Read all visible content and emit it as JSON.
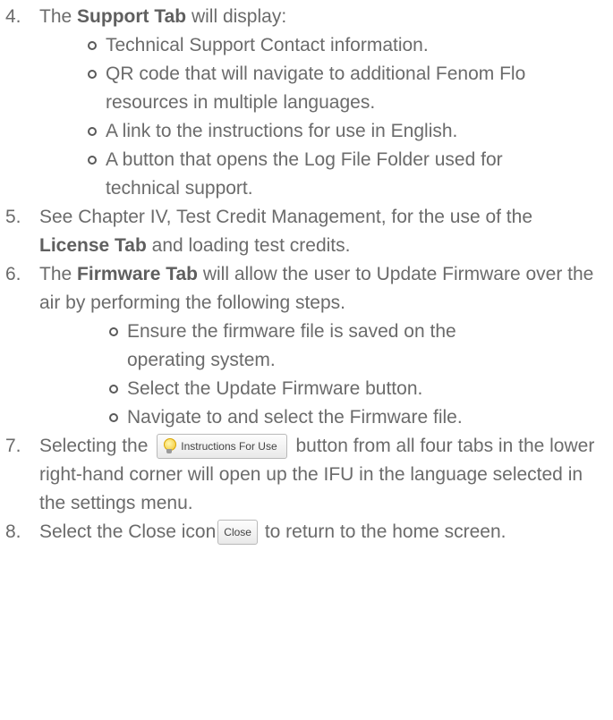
{
  "items": [
    {
      "num": "4.",
      "pre": "The ",
      "bold": "Support Tab",
      "post": " will display:",
      "bullets": [
        "Technical Support Contact information.",
        "QR code that will navigate to additional Fenom Flo resources in multiple languages.",
        "A link to the instructions for use in English.",
        "A button that opens the Log File Folder used for technical support."
      ]
    },
    {
      "num": "5.",
      "pre": "See Chapter IV, Test Credit Management, for the use of the ",
      "bold": "License Tab",
      "post": " and loading test credits."
    },
    {
      "num": "6.",
      "pre": "The ",
      "bold": "Firmware Tab",
      "post": " will allow the user to Update Firmware over the air by performing the following steps.",
      "bullets": [
        "Ensure the firmware file is saved on the operating system.",
        "Select the Update Firmware button.",
        "Navigate to and select the Firmware file."
      ]
    },
    {
      "num": "7.",
      "pre": "Selecting the",
      "button_label": "Instructions For Use",
      "post": "button from all four tabs in the lower right-hand corner will open up the IFU in the language selected in the settings menu."
    },
    {
      "num": "8.",
      "pre": "Select the Close icon",
      "button_label": "Close",
      "post": "to return to the home screen."
    }
  ]
}
